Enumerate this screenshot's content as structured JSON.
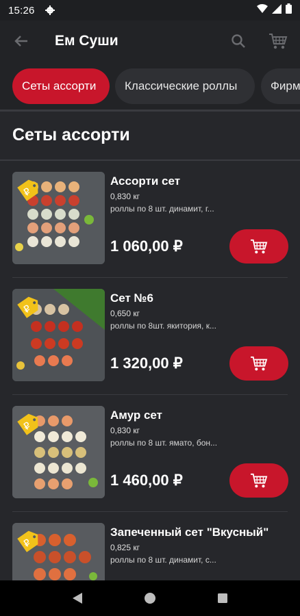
{
  "status_bar": {
    "time": "15:26",
    "icons": [
      "gear-icon",
      "wifi-icon",
      "signal-icon",
      "battery-icon"
    ]
  },
  "app_bar": {
    "title": "Ем Суши",
    "icons": [
      "back-arrow-icon",
      "search-icon",
      "cart-icon"
    ]
  },
  "tabs": [
    {
      "label": "Сеты ассорти",
      "selected": true
    },
    {
      "label": "Классические роллы",
      "selected": false
    },
    {
      "label": "Фирм",
      "selected": false
    }
  ],
  "section": {
    "title": "Сеты ассорти"
  },
  "products": [
    {
      "name": "Ассорти сет",
      "weight": "0,830 кг",
      "description": "роллы по 8 шт. динамит, г...",
      "price": "1 060,00 ₽"
    },
    {
      "name": "Сет №6",
      "weight": "0,650 кг",
      "description": "роллы по 8шт. якитория, к...",
      "price": "1 320,00 ₽"
    },
    {
      "name": "Амур сет",
      "weight": "0,830 кг",
      "description": "роллы по 8 шт. ямато, бон...",
      "price": "1 460,00 ₽"
    },
    {
      "name": "Запеченный сет \"Вкусный\"",
      "weight": "0,825 кг",
      "description": "роллы по 8 шт. динамит, с...",
      "price": ""
    }
  ],
  "colors": {
    "accent": "#c8162b",
    "background": "#26272b",
    "app_bar": "#222326"
  },
  "nav_bar": {
    "icons": [
      "back-triangle-icon",
      "home-circle-icon",
      "recents-square-icon"
    ]
  }
}
